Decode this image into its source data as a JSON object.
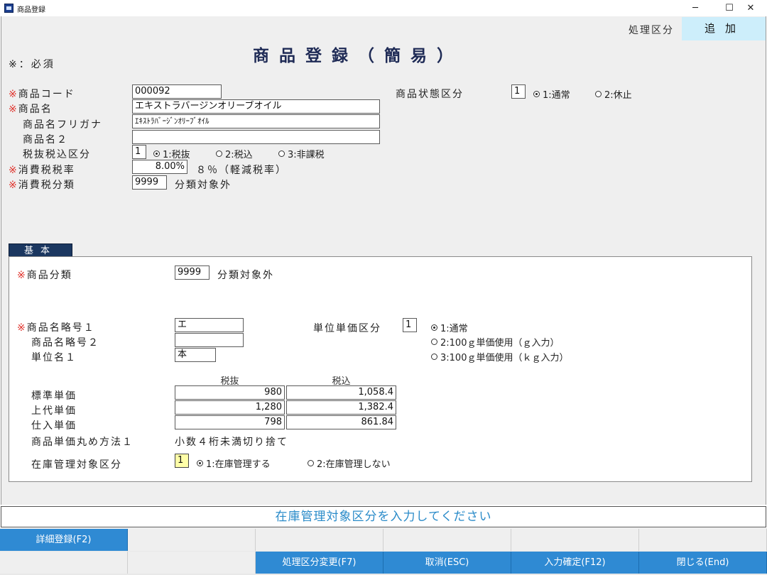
{
  "window": {
    "title": "商品登録",
    "minimize": "─",
    "maximize": "☐",
    "close": "✕"
  },
  "header": {
    "process_label": "処理区分",
    "process_value": "追加",
    "page_title": "商品登録（簡易）",
    "required_note": "※：必須",
    "required_mark": "※"
  },
  "form": {
    "product_code": {
      "label": "商品コード",
      "value": "000092"
    },
    "product_status": {
      "label": "商品状態区分",
      "value": "1",
      "options": [
        "1:通常",
        "2:休止"
      ],
      "selected": 0
    },
    "product_name": {
      "label": "商品名",
      "value": "エキストラバージンオリーブオイル"
    },
    "product_kana": {
      "label": "商品名フリガナ",
      "value": "ｴｷｽﾄﾗﾊﾞｰｼﾞﾝｵﾘｰﾌﾞｵｲﾙ"
    },
    "product_name2": {
      "label": "商品名２",
      "value": ""
    },
    "tax_type": {
      "label": "税抜税込区分",
      "value": "1",
      "options": [
        "1:税抜",
        "2:税込",
        "3:非課税"
      ],
      "selected": 0
    },
    "tax_rate": {
      "label": "消費税税率",
      "value": "8.00%",
      "note": "８％（軽減税率）"
    },
    "tax_class": {
      "label": "消費税分類",
      "value": "9999",
      "note": "分類対象外"
    }
  },
  "tab": {
    "label": "基本"
  },
  "basic": {
    "category": {
      "label": "商品分類",
      "value": "9999",
      "note": "分類対象外"
    },
    "abbr1": {
      "label": "商品名略号１",
      "value": "エ"
    },
    "abbr2": {
      "label": "商品名略号２",
      "value": ""
    },
    "unit1": {
      "label": "単位名１",
      "value": "本"
    },
    "unit_price_type": {
      "label": "単位単価区分",
      "value": "1",
      "options": [
        "1:通常",
        "2:100ｇ単価使用（ｇ入力）",
        "3:100ｇ単価使用（ｋｇ入力）"
      ],
      "selected": 0
    },
    "price_headers": [
      "税抜",
      "税込"
    ],
    "prices": [
      {
        "label": "標準単価",
        "ex": "980",
        "inc": "1,058.4"
      },
      {
        "label": "上代単価",
        "ex": "1,280",
        "inc": "1,382.4"
      },
      {
        "label": "仕入単価",
        "ex": "798",
        "inc": "861.84"
      }
    ],
    "rounding": {
      "label": "商品単価丸め方法１",
      "value": "小数４桁未満切り捨て"
    },
    "stock": {
      "label": "在庫管理対象区分",
      "value": "1",
      "options": [
        "1:在庫管理する",
        "2:在庫管理しない"
      ],
      "selected": 0
    }
  },
  "status_message": "在庫管理対象区分を入力してください",
  "footer": {
    "row1": [
      "詳細登録(F2)",
      "",
      "",
      "",
      "",
      ""
    ],
    "row2": [
      "",
      "",
      "処理区分変更(F7)",
      "取消(ESC)",
      "入力確定(F12)",
      "閉じる(End)"
    ]
  },
  "colors": {
    "accent": "#2f8ad3",
    "required": "#e0322b",
    "title": "#1e2a55",
    "tab": "#1b3760",
    "process_bg": "#cdeefb"
  }
}
